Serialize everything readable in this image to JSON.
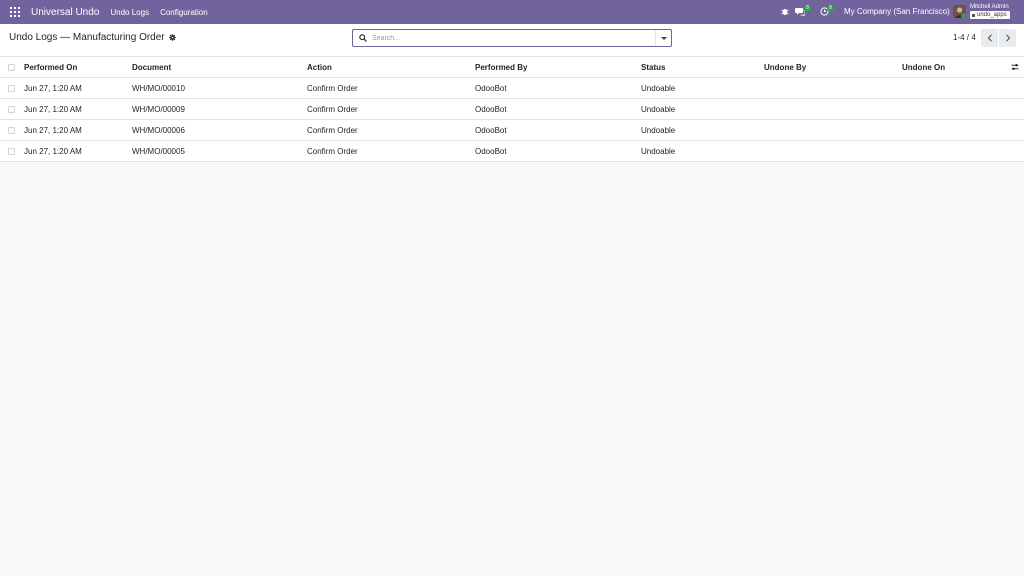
{
  "navbar": {
    "app_name": "Universal Undo",
    "menu": [
      "Undo Logs",
      "Configuration"
    ],
    "chat_badge": "8",
    "activity_badge": "8",
    "company": "My Company (San Francisco)",
    "user": "Mitchell Admin",
    "db": "undo_apps"
  },
  "control": {
    "breadcrumb": "Undo Logs — Manufacturing Order",
    "search_placeholder": "Search...",
    "pager": "1-4 / 4"
  },
  "table": {
    "headers": [
      "Performed On",
      "Document",
      "Action",
      "Performed By",
      "Status",
      "Undone By",
      "Undone On"
    ],
    "rows": [
      {
        "performed_on": "Jun 27, 1:20 AM",
        "document": "WH/MO/00010",
        "action": "Confirm Order",
        "performed_by": "OdooBot",
        "status": "Undoable",
        "undone_by": "",
        "undone_on": ""
      },
      {
        "performed_on": "Jun 27, 1:20 AM",
        "document": "WH/MO/00009",
        "action": "Confirm Order",
        "performed_by": "OdooBot",
        "status": "Undoable",
        "undone_by": "",
        "undone_on": ""
      },
      {
        "performed_on": "Jun 27, 1:20 AM",
        "document": "WH/MO/00006",
        "action": "Confirm Order",
        "performed_by": "OdooBot",
        "status": "Undoable",
        "undone_by": "",
        "undone_on": ""
      },
      {
        "performed_on": "Jun 27, 1:20 AM",
        "document": "WH/MO/00005",
        "action": "Confirm Order",
        "performed_by": "OdooBot",
        "status": "Undoable",
        "undone_by": "",
        "undone_on": ""
      }
    ]
  },
  "colors": {
    "navbar": "#71639e",
    "badge": "#28a745"
  }
}
